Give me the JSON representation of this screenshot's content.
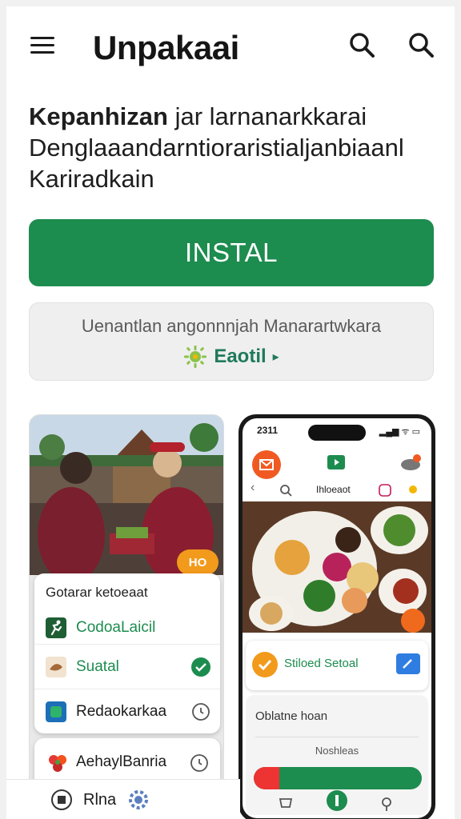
{
  "header": {
    "title": "Unpakaai",
    "menu_icon": "hamburger-menu-icon",
    "search_icon_1": "search-icon",
    "search_icon_2": "search-icon"
  },
  "headline": {
    "line1_bold": "Kepanhizan",
    "line1_rest": "jar larnanarkkarai",
    "line2": "Denglaaandarntioraristialjanbiaanl",
    "line3": "Kariradkain"
  },
  "install": {
    "label": "INSTAL",
    "color": "#1d8c4f"
  },
  "promo": {
    "text": "Uenantlan angonnnjah Manarartwkara",
    "link_text": "Eaotil",
    "link_arrow": "▸",
    "link_icon": "sun-icon"
  },
  "left_screenshot": {
    "badge": "HO",
    "card_title": "Gotarar ketoeaat",
    "items": [
      {
        "label": "CodoaLaicil",
        "icon": "running-figure-icon",
        "color": "#1d8c4f"
      },
      {
        "label": "Suatal",
        "icon": "cookie-icon",
        "color": "#1d8c4f"
      },
      {
        "label": "Redaokarkaa",
        "icon": "app-icon",
        "color": "#1b1b1b"
      }
    ],
    "second_card_label": "AehaylBanria",
    "second_card_icon": "flower-icon"
  },
  "phone": {
    "status_time": "2311",
    "status_icons": "▂▄▆ ᯤ ▭",
    "app_bar_label": "Ihloeaot",
    "order_label": "Stiloed Setoal",
    "info_title": "Oblatne hoan",
    "info_sub": "Noshleas"
  },
  "bottom_bar": {
    "label": "Rlna",
    "left_icon": "grid-icon",
    "right_icon": "gear-icon"
  }
}
